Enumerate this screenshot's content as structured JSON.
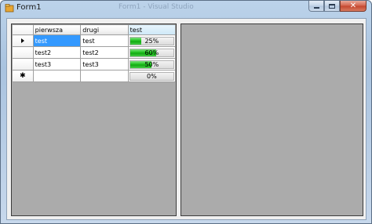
{
  "window": {
    "title": "Form1",
    "ghost_title": "Form1 - Visual Studio",
    "close_glyph": "✕"
  },
  "grid": {
    "columns": [
      "pierwsza",
      "drugi",
      "test"
    ],
    "rows": [
      {
        "pierwsza": "test",
        "drugi": "test",
        "progress_label": "25%",
        "progress": 0.25,
        "current": true
      },
      {
        "pierwsza": "test2",
        "drugi": "test2",
        "progress_label": "60%",
        "progress": 0.6,
        "current": false
      },
      {
        "pierwsza": "test3",
        "drugi": "test3",
        "progress_label": "50%",
        "progress": 0.5,
        "current": false
      }
    ],
    "new_row": {
      "marker": "✱",
      "progress_label": "0%",
      "progress": 0.0
    }
  },
  "icons": [
    "app-icon",
    "minimize-icon",
    "maximize-icon",
    "close-icon",
    "current-row-arrow-icon",
    "new-row-star-icon"
  ],
  "colors": {
    "selection": "#3399ff",
    "progress_green": "#1ec21e",
    "grid_background": "#ababab",
    "panel_background": "#ababab"
  }
}
